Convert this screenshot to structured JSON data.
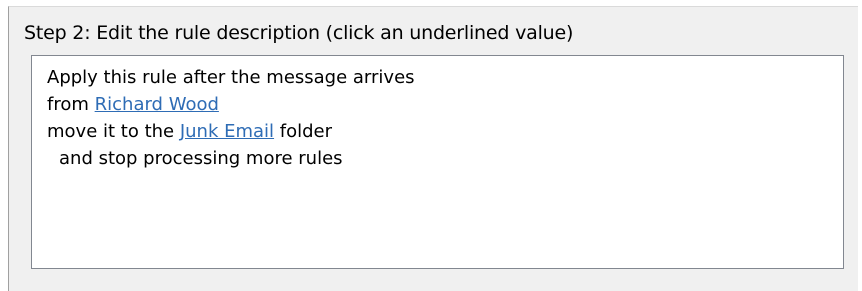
{
  "step2": {
    "heading": "Step 2: Edit the rule description (click an underlined value)",
    "lines": [
      {
        "text": "Apply this rule after the message arrives"
      },
      {
        "prefix": "from ",
        "link": "Richard Wood",
        "suffix": ""
      },
      {
        "prefix": "move it to the ",
        "link": "Junk Email",
        "suffix": " folder"
      },
      {
        "text": "and stop processing more rules"
      }
    ]
  },
  "colors": {
    "panel_background": "#f0f0f0",
    "link": "#2e6cb5",
    "box_border": "#828790"
  }
}
